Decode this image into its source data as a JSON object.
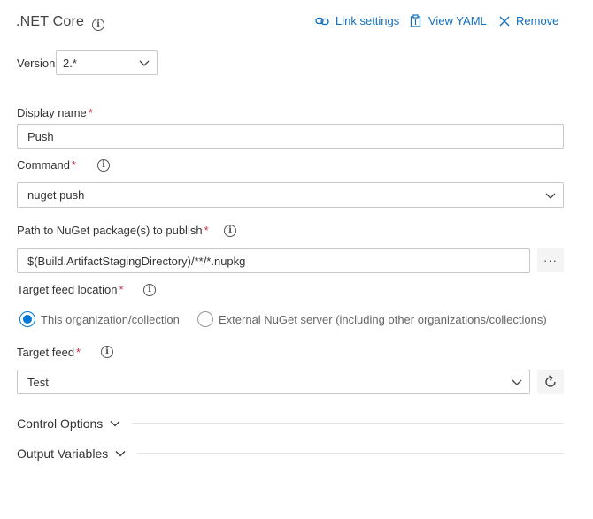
{
  "header": {
    "title": ".NET Core",
    "link_settings": "Link settings",
    "view_yaml": "View YAML",
    "remove": "Remove"
  },
  "version": {
    "label": "Version",
    "value": "2.*"
  },
  "display_name": {
    "label": "Display name",
    "required_mark": "*",
    "value": "Push"
  },
  "command": {
    "label": "Command",
    "required_mark": "*",
    "value": "nuget push"
  },
  "path": {
    "label": "Path to NuGet package(s) to publish",
    "required_mark": "*",
    "value": "$(Build.ArtifactStagingDirectory)/**/*.nupkg",
    "browse_label": "···"
  },
  "target_feed_location": {
    "label": "Target feed location",
    "required_mark": "*",
    "options": [
      {
        "label": "This organization/collection",
        "selected": true
      },
      {
        "label": "External NuGet server (including other organizations/collections)",
        "selected": false
      }
    ]
  },
  "target_feed": {
    "label": "Target feed",
    "required_mark": "*",
    "value": "Test"
  },
  "sections": {
    "control_options": "Control Options",
    "output_variables": "Output Variables"
  },
  "colors": {
    "accent": "#0078d4",
    "link": "#106ebe",
    "required": "#c4314b"
  },
  "icons": [
    "info-icon",
    "link-icon",
    "yaml-clipboard-icon",
    "close-icon",
    "chevron-down-icon",
    "refresh-icon"
  ]
}
